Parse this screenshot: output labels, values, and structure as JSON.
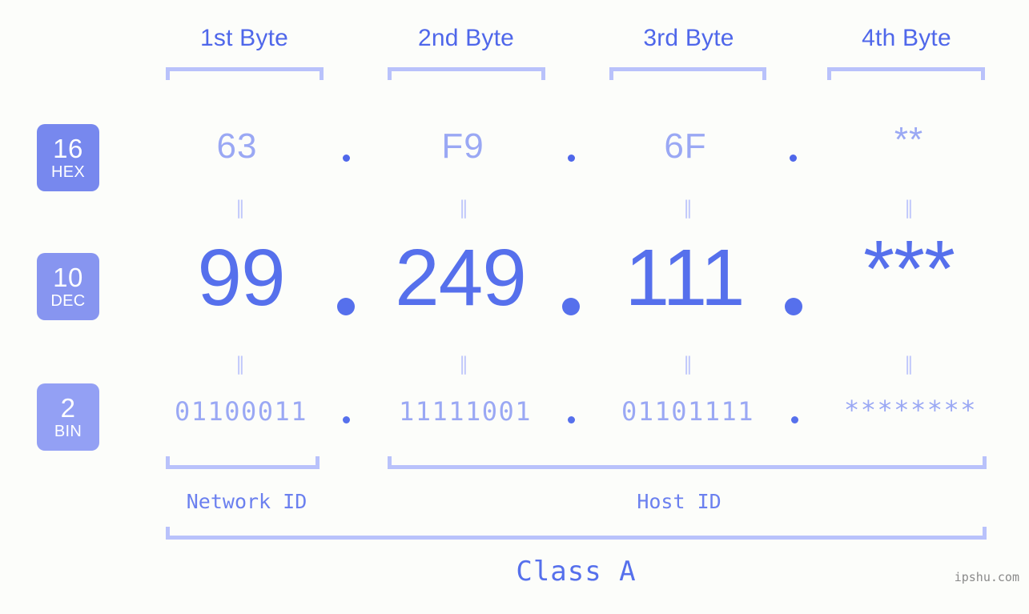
{
  "page": {
    "background_color": "#fcfdfa",
    "watermark": "ipshu.com"
  },
  "colors": {
    "accent_strong": "#4f67ea",
    "accent_dec": "#5670ec",
    "accent_light": "#9aa8f4",
    "bracket": "#b9c2fb",
    "badge_hex": "#7788ee",
    "badge_dec": "#8795f0",
    "badge_bin": "#93a0f4",
    "watermark": "#8a8a8a"
  },
  "byte_headers": [
    {
      "label": "1st Byte"
    },
    {
      "label": "2nd Byte"
    },
    {
      "label": "3rd Byte"
    },
    {
      "label": "4th Byte"
    }
  ],
  "bases": [
    {
      "number": "16",
      "name": "HEX"
    },
    {
      "number": "10",
      "name": "DEC"
    },
    {
      "number": "2",
      "name": "BIN"
    }
  ],
  "rows": {
    "hex": {
      "base_number": "16",
      "base_name": "HEX",
      "values": [
        "63",
        "F9",
        "6F",
        "**"
      ]
    },
    "dec": {
      "base_number": "10",
      "base_name": "DEC",
      "values": [
        "99",
        "249",
        "111",
        "***"
      ]
    },
    "bin": {
      "base_number": "2",
      "base_name": "BIN",
      "values": [
        "01100011",
        "11111001",
        "01101111",
        "********"
      ]
    }
  },
  "separators": {
    "dot": ".",
    "equals": "‖"
  },
  "segments": {
    "network_id": "Network ID",
    "host_id": "Host ID",
    "class": "Class A"
  }
}
